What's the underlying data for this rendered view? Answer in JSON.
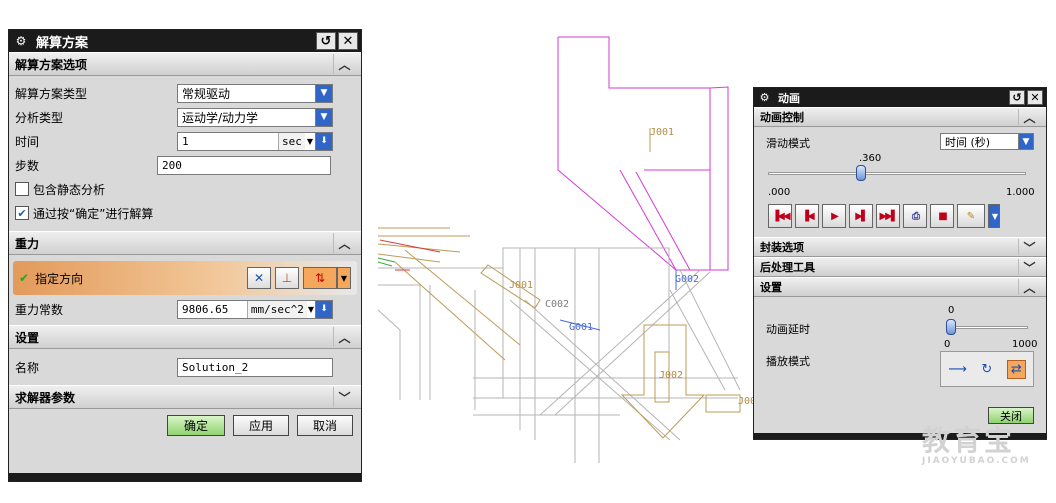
{
  "solution_dialog": {
    "title": "解算方案",
    "reset_symbol": "↺",
    "close_symbol": "✕",
    "sections": {
      "options": "解算方案选项",
      "gravity": "重力",
      "settings": "设置",
      "solver": "求解器参数"
    },
    "fields": {
      "solution_type_label": "解算方案类型",
      "solution_type_value": "常规驱动",
      "analysis_type_label": "分析类型",
      "analysis_type_value": "运动学/动力学",
      "time_label": "时间",
      "time_value": "1",
      "time_unit": "sec",
      "steps_label": "步数",
      "steps_value": "200",
      "static_check_label": "包含静态分析",
      "static_checked": false,
      "ok_solve_label": "通过按“确定”进行解算",
      "ok_solve_checked": true,
      "direction_label": "指定方向",
      "gravity_const_label": "重力常数",
      "gravity_const_value": "9806.65",
      "gravity_unit": "mm/sec^2",
      "name_label": "名称",
      "name_value": "Solution_2"
    },
    "buttons": {
      "ok": "确定",
      "apply": "应用",
      "cancel": "取消"
    },
    "colors": {
      "titlebar": "#1b1b1b",
      "direction_highlight": "#e39a5a",
      "ok_button": "#8fd36f"
    }
  },
  "animation_dialog": {
    "title": "动画",
    "reset_symbol": "↺",
    "close_symbol": "✕",
    "sections": {
      "control": "动画控制",
      "package": "封装选项",
      "postproc": "后处理工具",
      "settings": "设置"
    },
    "scrub_mode_label": "滑动模式",
    "scrub_mode_value": "时间 (秒)",
    "slider_value": ".360",
    "slider_min": ".000",
    "slider_max": "1.000",
    "slider_fraction": 0.36,
    "delay_label": "动画延时",
    "delay_value": "0",
    "delay_min": "0",
    "delay_max": "1000",
    "playback_label": "播放模式",
    "close_button": "关闭"
  },
  "cad_labels": {
    "j001_top": "J001",
    "j001_mid": "J001",
    "c002": "C002",
    "g002": "G002",
    "g001": "G001",
    "j002": "J002",
    "j00_right": "J00"
  },
  "watermark": {
    "text": "教育宝",
    "url": "JIAOYUBAO.COM"
  }
}
